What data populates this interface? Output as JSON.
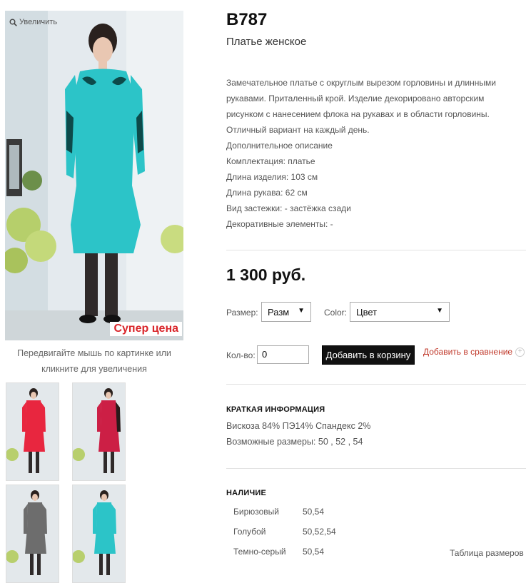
{
  "product": {
    "sku": "B787",
    "name": "Платье женское",
    "zoom_label": "Увеличить",
    "promo_label": "Супер цена",
    "image_hint": [
      "Передвигайте мышь по картинке или",
      "кликните для увеличения"
    ],
    "description": [
      "Замечательное платье с округлым вырезом горловины и длинными",
      "рукавами. Приталенный крой. Изделие декорировано авторским",
      "рисунком с нанесением флока на рукавах и в области горловины.",
      "Отличный вариант на каждый день.",
      "Дополнительное описание",
      "Комплектация: платье",
      "Длина изделия: 103 см",
      "Длина рукава: 62 см",
      "Вид застежки: - застёжка сзади",
      "Декоративные элементы: -"
    ],
    "price": "1 300 руб.",
    "colors": {
      "turquoise": "#2cc4c8",
      "red": "#e8263f",
      "crimson": "#cc1f45",
      "grey": "#6d6d6d",
      "promo_red": "#d9262b"
    }
  },
  "thumbnails": [
    {
      "icon": "dress-red",
      "color": "red"
    },
    {
      "icon": "dress-crimson",
      "color": "crimson"
    },
    {
      "icon": "dress-grey",
      "color": "grey"
    },
    {
      "icon": "dress-turquoise",
      "color": "turquoise"
    }
  ],
  "options": {
    "size_label": "Размер:",
    "size_value": "Разм",
    "color_label": "Color:",
    "color_value": "Цвет"
  },
  "cart": {
    "qty_label": "Кол-во:",
    "qty_value": "0",
    "add_button": "Добавить в корзину",
    "compare_link": "Добавить в сравнение"
  },
  "brief_info": {
    "title": "КРАТКАЯ ИНФОРМАЦИЯ",
    "composition": "Вискоза 84% ПЭ14% Спандекс 2%",
    "sizes": "Возможные размеры: 50 , 52 , 54"
  },
  "availability": {
    "title": "НАЛИЧИЕ",
    "rows": [
      {
        "color": "Бирюзовый",
        "sizes": "50,54"
      },
      {
        "color": "Голубой",
        "sizes": "50,52,54"
      },
      {
        "color": "Темно-серый",
        "sizes": "50,54"
      }
    ],
    "size_table_link": "Таблица размеров"
  }
}
